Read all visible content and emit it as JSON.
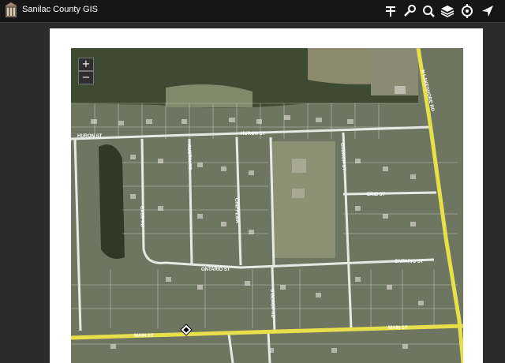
{
  "app": {
    "title": "Sanilac County GIS"
  },
  "toolbar": {
    "buttons": [
      {
        "name": "layers-list-icon"
      },
      {
        "name": "wrench-icon"
      },
      {
        "name": "search-icon"
      },
      {
        "name": "basemap-layers-icon"
      },
      {
        "name": "locate-icon"
      },
      {
        "name": "share-arrow-icon"
      }
    ]
  },
  "zoom": {
    "in_label": "+",
    "out_label": "−"
  },
  "streets": {
    "huron_west": "HURON ST",
    "huron_east": "HURON ST",
    "lakeshore": "N LAKESHORE RD",
    "austin": "AUSTIN RD",
    "chippewa": "CHIPPEWA",
    "church": "CHURCH ST",
    "erie": "ERIE ST",
    "cass": "CASS RD",
    "ontario_west": "ONTARIO ST",
    "ontario_east": "ONTARIO ST",
    "main_west": "MAIN ST",
    "main_east": "MAIN ST",
    "south": "S BLACK RD"
  },
  "colors": {
    "highway": "#e8e04a",
    "parcel_line": "#ffffff",
    "topbar": "#161616"
  }
}
